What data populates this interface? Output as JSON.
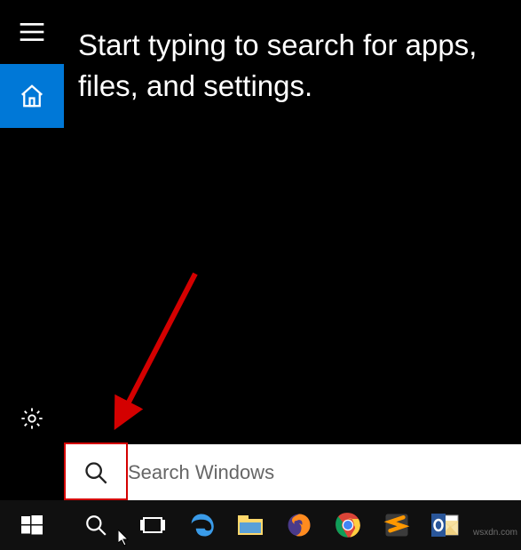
{
  "hint_text": "Start typing to search for apps, files, and settings.",
  "search": {
    "placeholder": "Search Windows",
    "value": ""
  },
  "sidebar": {
    "hamburger_label": "Menu",
    "home_label": "Home",
    "settings_label": "Settings"
  },
  "taskbar": {
    "items": [
      {
        "name": "start",
        "label": "Start"
      },
      {
        "name": "search",
        "label": "Search"
      },
      {
        "name": "task-view",
        "label": "Task View"
      },
      {
        "name": "edge",
        "label": "Microsoft Edge"
      },
      {
        "name": "explorer",
        "label": "File Explorer"
      },
      {
        "name": "firefox",
        "label": "Firefox"
      },
      {
        "name": "chrome",
        "label": "Google Chrome"
      },
      {
        "name": "sublime",
        "label": "Sublime Text"
      },
      {
        "name": "outlook",
        "label": "Outlook"
      }
    ]
  },
  "annotation": {
    "arrow_color": "#d40000",
    "highlight_color": "#d40000"
  },
  "watermark": "wsxdn.com"
}
